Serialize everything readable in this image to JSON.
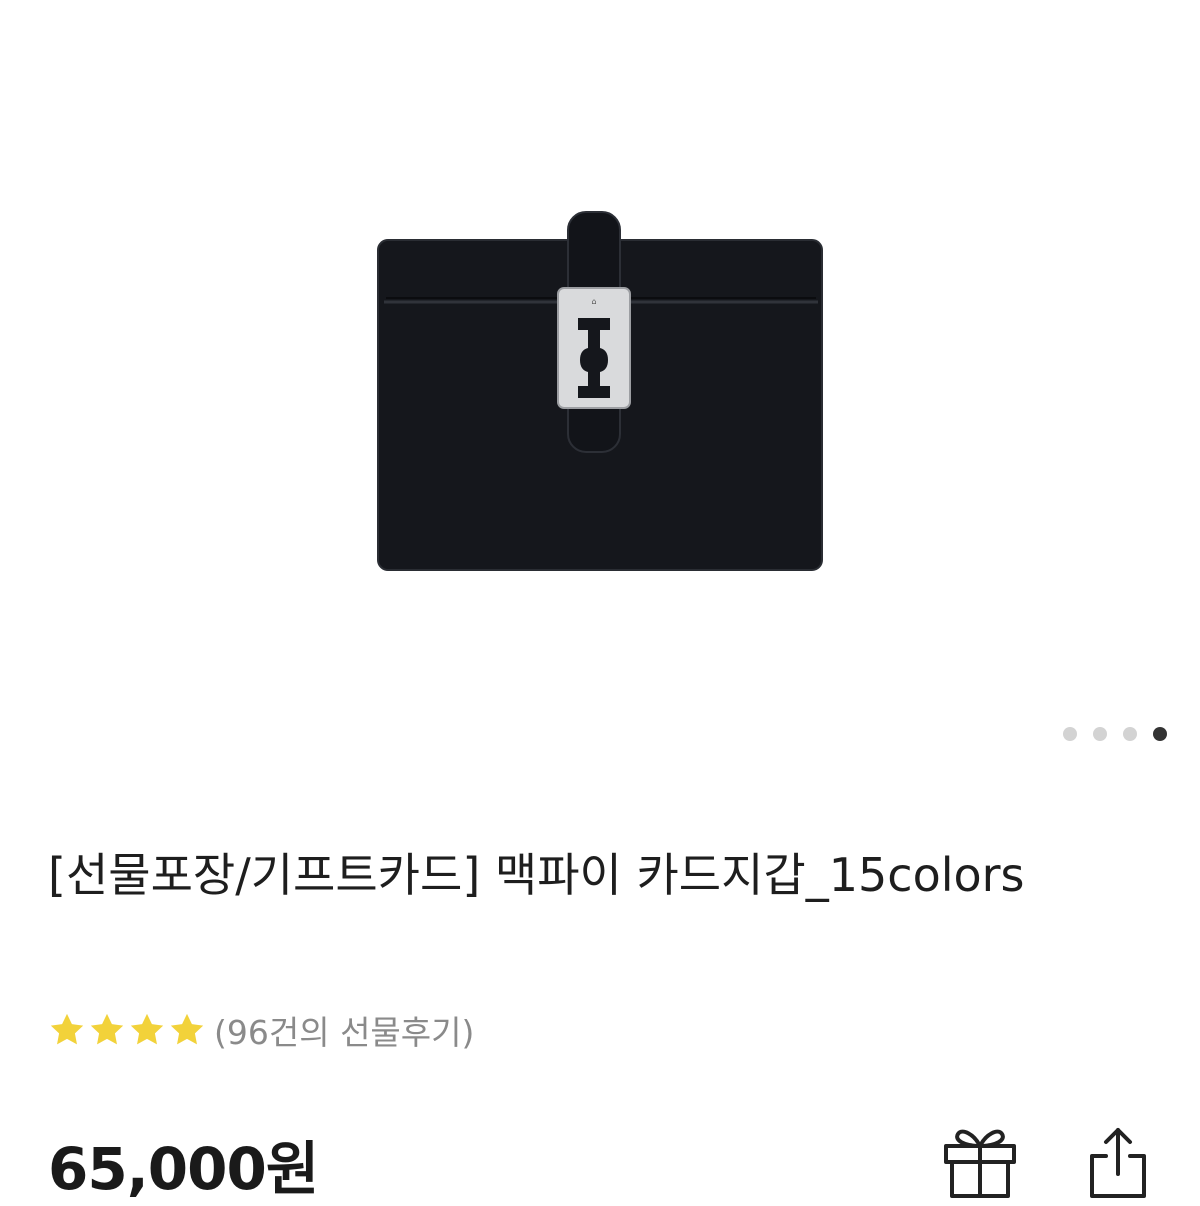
{
  "gallery": {
    "image_alt": "black leather card wallet",
    "page_count": 4,
    "active_page": 4
  },
  "product": {
    "title": "[선물포장/기프트카드] 맥파이 카드지갑_15colors",
    "rating": 4,
    "rating_max": 5,
    "review_count_text": "(96건의 선물후기)",
    "price": "65,000원"
  },
  "actions": {
    "gift_icon": "gift-icon",
    "share_icon": "share-icon"
  },
  "colors": {
    "star": "#f2d23a",
    "pager_active": "#333333",
    "pager_inactive": "#d3d3d3",
    "wallet": "#15171c"
  }
}
